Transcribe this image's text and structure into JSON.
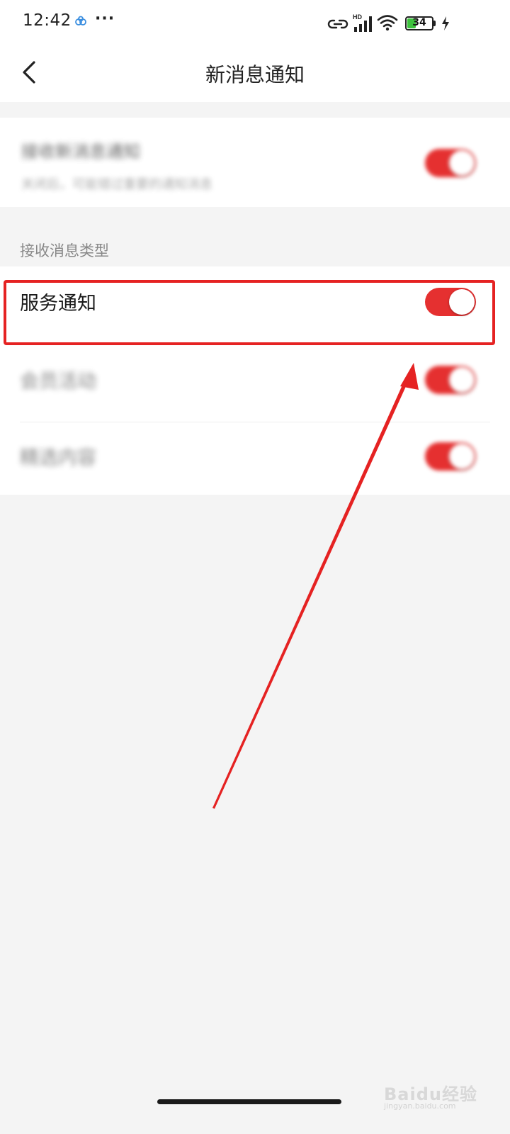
{
  "status_bar": {
    "time": "12:42",
    "more": "···",
    "signal_badge": "HD",
    "battery_level": "34",
    "battery_fraction": 0.34,
    "icons": [
      "app-notification-icon",
      "link-icon",
      "signal-icon",
      "wifi-icon",
      "battery-icon",
      "charging-bolt-icon"
    ]
  },
  "header": {
    "title": "新消息通知",
    "back_icon": "chevron-left-icon"
  },
  "master_setting": {
    "label": "接收新消息通知",
    "description": "关闭后，可能错过重要的通知消息",
    "enabled": true
  },
  "section": {
    "label": "接收消息类型"
  },
  "notification_types": [
    {
      "label": "服务通知",
      "enabled": true
    },
    {
      "label": "会员活动",
      "enabled": true
    },
    {
      "label": "精选内容",
      "enabled": true
    }
  ],
  "colors": {
    "accent": "#e53030",
    "annotation": "#e52222",
    "background": "#f4f4f4"
  },
  "watermark": {
    "text": "Baidu经验",
    "url": "jingyan.baidu.com"
  }
}
